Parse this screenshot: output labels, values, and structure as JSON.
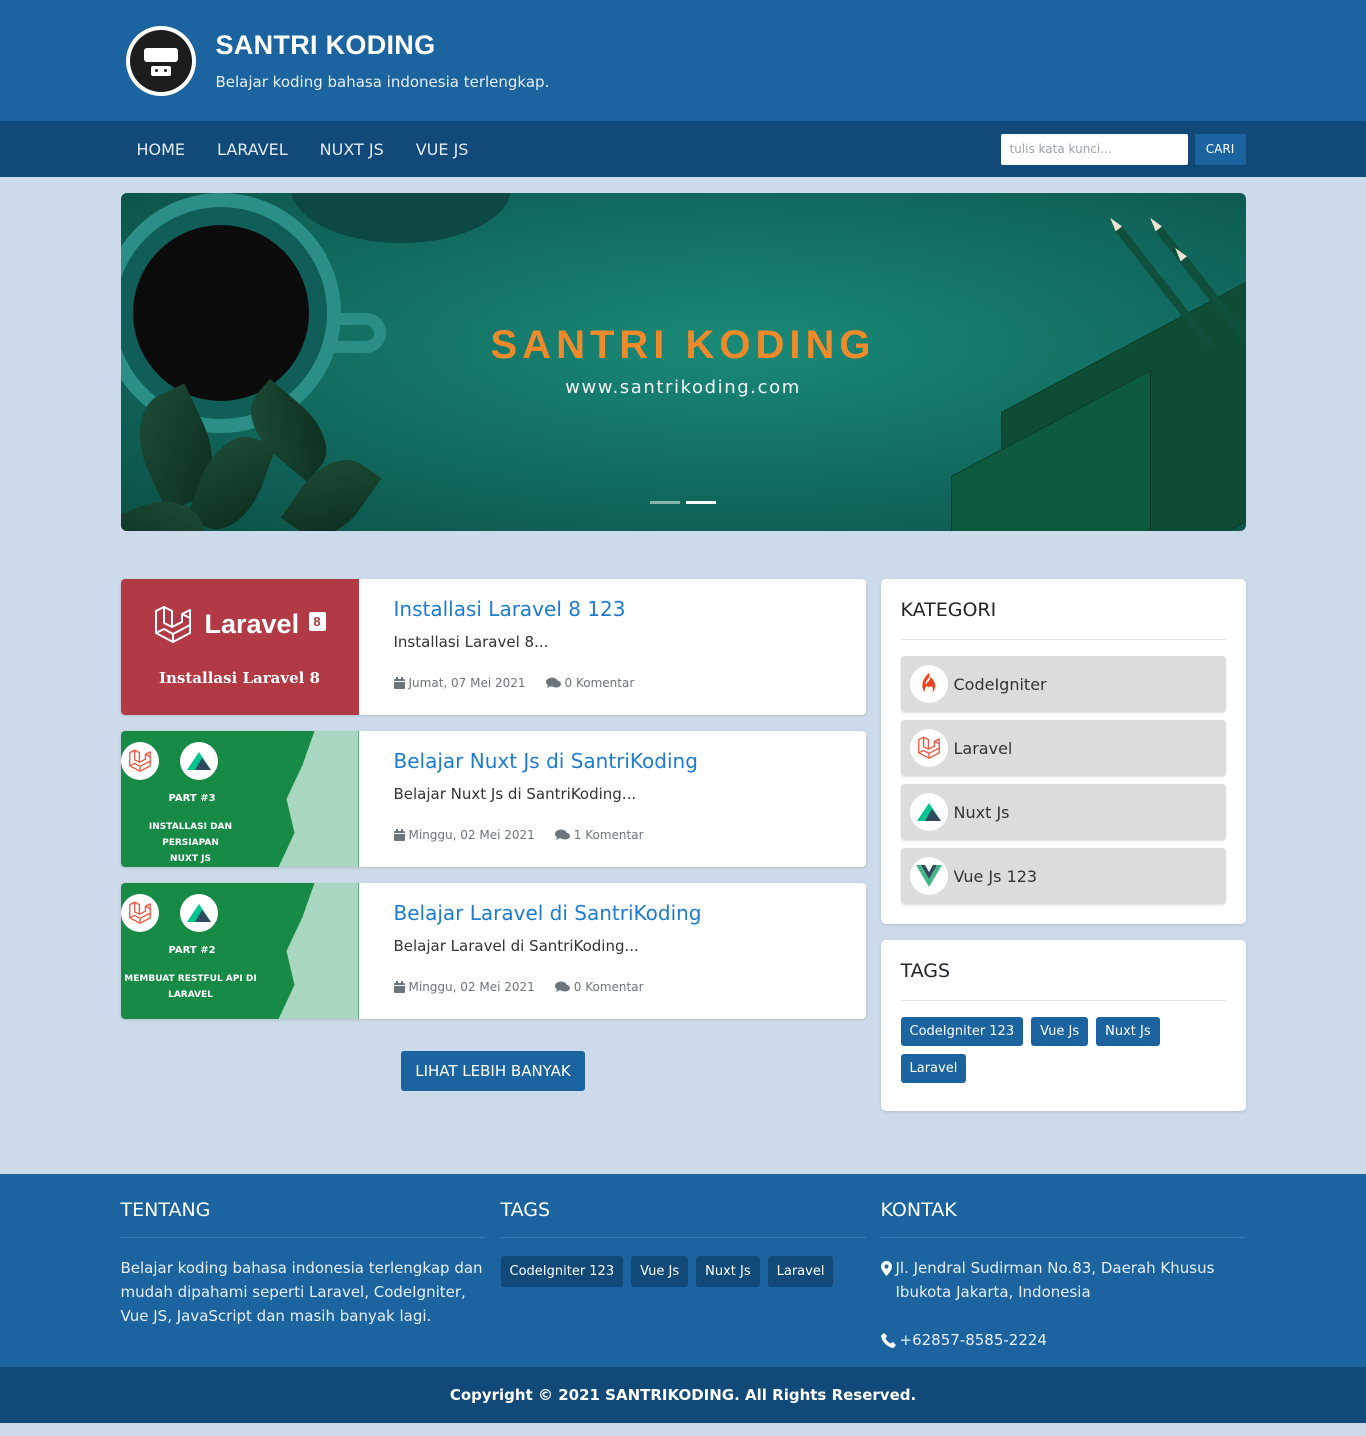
{
  "header": {
    "title": "SANTRI KODING",
    "subtitle": "Belajar koding bahasa indonesia terlengkap."
  },
  "nav": {
    "items": [
      "HOME",
      "LARAVEL",
      "NUXT JS",
      "VUE JS"
    ],
    "search_placeholder": "tulis kata kunci...",
    "search_button": "CARI"
  },
  "slider": {
    "title": "SANTRI KODING",
    "url": "www.santrikoding.com",
    "slide_count": 2,
    "active_slide": 2
  },
  "posts": [
    {
      "title": "Installasi Laravel 8 123",
      "excerpt": "Installasi Laravel 8...",
      "date": "Jumat, 07 Mei 2021",
      "comments": "0 Komentar",
      "thumb_brand": "Laravel",
      "thumb_badge": "8",
      "thumb_caption": "Installasi Laravel 8"
    },
    {
      "title": "Belajar Nuxt Js di SantriKoding",
      "excerpt": "Belajar Nuxt Js di SantriKoding...",
      "date": "Minggu, 02 Mei 2021",
      "comments": "1 Komentar",
      "thumb_part": "PART #3",
      "thumb_caption_1": "INSTALLASI DAN PERSIAPAN",
      "thumb_caption_2": "NUXT JS"
    },
    {
      "title": "Belajar Laravel di SantriKoding",
      "excerpt": "Belajar Laravel di SantriKoding...",
      "date": "Minggu, 02 Mei 2021",
      "comments": "0 Komentar",
      "thumb_part": "PART #2",
      "thumb_caption_1": "MEMBUAT RESTFUL API DI",
      "thumb_caption_2": "LARAVEL"
    }
  ],
  "more_button": "LIHAT LEBIH BANYAK",
  "sidebar": {
    "category_title": "KATEGORI",
    "categories": [
      {
        "label": "CodeIgniter",
        "icon": "codeigniter-icon"
      },
      {
        "label": "Laravel",
        "icon": "laravel-icon"
      },
      {
        "label": "Nuxt Js",
        "icon": "nuxt-icon"
      },
      {
        "label": "Vue Js 123",
        "icon": "vue-icon"
      }
    ],
    "tags_title": "TAGS",
    "tags": [
      "CodeIgniter 123",
      "Vue Js",
      "Nuxt Js",
      "Laravel"
    ]
  },
  "footer": {
    "about_title": "TENTANG",
    "about_text": "Belajar koding bahasa indonesia terlengkap dan mudah dipahami seperti Laravel, CodeIgniter, Vue JS, JavaScript dan masih banyak lagi.",
    "tags_title": "TAGS",
    "tags": [
      "CodeIgniter 123",
      "Vue Js",
      "Nuxt Js",
      "Laravel"
    ],
    "contact_title": "KONTAK",
    "address": "Jl. Jendral Sudirman No.83, Daerah Khusus Ibukota Jakarta, Indonesia",
    "phone": "+62857-8585-2224",
    "copyright": "Copyright © 2021 SANTRIKODING. All Rights Reserved."
  },
  "colors": {
    "primary": "#1b64a0",
    "primary_dark": "#114a79",
    "background": "#cddaea",
    "link": "#1d7bd0",
    "slider_accent": "#ee8a2a"
  }
}
